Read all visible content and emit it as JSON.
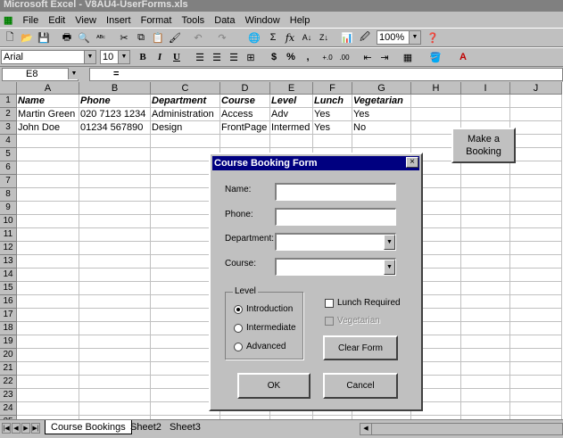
{
  "window": {
    "title": "Microsoft Excel - V8AU4-UserForms.xls"
  },
  "menu": [
    "File",
    "Edit",
    "View",
    "Insert",
    "Format",
    "Tools",
    "Data",
    "Window",
    "Help"
  ],
  "toolbar": {
    "zoom": "100%",
    "font": "Arial",
    "font_size": "10",
    "bold": "B",
    "italic": "I",
    "underline": "U",
    "currency": "$",
    "percent": "%",
    "comma": ","
  },
  "formula_bar": {
    "cell_ref": "E8",
    "equals": "=",
    "content": ""
  },
  "columns": [
    "A",
    "B",
    "C",
    "D",
    "E",
    "F",
    "G",
    "H",
    "I",
    "J"
  ],
  "rows": [
    "1",
    "2",
    "3",
    "4",
    "5",
    "6",
    "7",
    "8",
    "9",
    "10",
    "11",
    "12",
    "13",
    "14",
    "15",
    "16",
    "17",
    "18",
    "19",
    "20",
    "21",
    "22",
    "23",
    "24",
    "25"
  ],
  "sheet": {
    "headers": [
      "Name",
      "Phone",
      "Department",
      "Course",
      "Level",
      "Lunch",
      "Vegetarian"
    ],
    "records": [
      [
        "Martin Green",
        "020 7123 1234",
        "Administration",
        "Access",
        "Adv",
        "Yes",
        "Yes"
      ],
      [
        "John Doe",
        "01234 567890",
        "Design",
        "FrontPage",
        "Intermed",
        "Yes",
        "No"
      ]
    ]
  },
  "make_booking_button": "Make a Booking",
  "dialog": {
    "title": "Course Booking Form",
    "close": "×",
    "name_label": "Name:",
    "phone_label": "Phone:",
    "department_label": "Department:",
    "course_label": "Course:",
    "level_group": "Level",
    "level_options": [
      "Introduction",
      "Intermediate",
      "Advanced"
    ],
    "level_selected": "Introduction",
    "lunch_label": "Lunch Required",
    "vegetarian_label": "Vegetarian",
    "clear_button": "Clear Form",
    "ok_button": "OK",
    "cancel_button": "Cancel"
  },
  "sheet_tabs": [
    "Course Bookings",
    "Sheet2",
    "Sheet3"
  ],
  "active_sheet": "Course Bookings"
}
